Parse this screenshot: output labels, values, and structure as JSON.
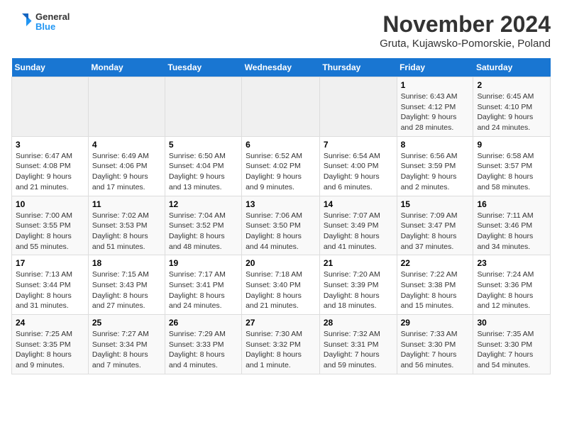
{
  "header": {
    "logo_line1": "General",
    "logo_line2": "Blue",
    "title": "November 2024",
    "subtitle": "Gruta, Kujawsko-Pomorskie, Poland"
  },
  "days_of_week": [
    "Sunday",
    "Monday",
    "Tuesday",
    "Wednesday",
    "Thursday",
    "Friday",
    "Saturday"
  ],
  "weeks": [
    [
      {
        "day": "",
        "info": ""
      },
      {
        "day": "",
        "info": ""
      },
      {
        "day": "",
        "info": ""
      },
      {
        "day": "",
        "info": ""
      },
      {
        "day": "",
        "info": ""
      },
      {
        "day": "1",
        "info": "Sunrise: 6:43 AM\nSunset: 4:12 PM\nDaylight: 9 hours and 28 minutes."
      },
      {
        "day": "2",
        "info": "Sunrise: 6:45 AM\nSunset: 4:10 PM\nDaylight: 9 hours and 24 minutes."
      }
    ],
    [
      {
        "day": "3",
        "info": "Sunrise: 6:47 AM\nSunset: 4:08 PM\nDaylight: 9 hours and 21 minutes."
      },
      {
        "day": "4",
        "info": "Sunrise: 6:49 AM\nSunset: 4:06 PM\nDaylight: 9 hours and 17 minutes."
      },
      {
        "day": "5",
        "info": "Sunrise: 6:50 AM\nSunset: 4:04 PM\nDaylight: 9 hours and 13 minutes."
      },
      {
        "day": "6",
        "info": "Sunrise: 6:52 AM\nSunset: 4:02 PM\nDaylight: 9 hours and 9 minutes."
      },
      {
        "day": "7",
        "info": "Sunrise: 6:54 AM\nSunset: 4:00 PM\nDaylight: 9 hours and 6 minutes."
      },
      {
        "day": "8",
        "info": "Sunrise: 6:56 AM\nSunset: 3:59 PM\nDaylight: 9 hours and 2 minutes."
      },
      {
        "day": "9",
        "info": "Sunrise: 6:58 AM\nSunset: 3:57 PM\nDaylight: 8 hours and 58 minutes."
      }
    ],
    [
      {
        "day": "10",
        "info": "Sunrise: 7:00 AM\nSunset: 3:55 PM\nDaylight: 8 hours and 55 minutes."
      },
      {
        "day": "11",
        "info": "Sunrise: 7:02 AM\nSunset: 3:53 PM\nDaylight: 8 hours and 51 minutes."
      },
      {
        "day": "12",
        "info": "Sunrise: 7:04 AM\nSunset: 3:52 PM\nDaylight: 8 hours and 48 minutes."
      },
      {
        "day": "13",
        "info": "Sunrise: 7:06 AM\nSunset: 3:50 PM\nDaylight: 8 hours and 44 minutes."
      },
      {
        "day": "14",
        "info": "Sunrise: 7:07 AM\nSunset: 3:49 PM\nDaylight: 8 hours and 41 minutes."
      },
      {
        "day": "15",
        "info": "Sunrise: 7:09 AM\nSunset: 3:47 PM\nDaylight: 8 hours and 37 minutes."
      },
      {
        "day": "16",
        "info": "Sunrise: 7:11 AM\nSunset: 3:46 PM\nDaylight: 8 hours and 34 minutes."
      }
    ],
    [
      {
        "day": "17",
        "info": "Sunrise: 7:13 AM\nSunset: 3:44 PM\nDaylight: 8 hours and 31 minutes."
      },
      {
        "day": "18",
        "info": "Sunrise: 7:15 AM\nSunset: 3:43 PM\nDaylight: 8 hours and 27 minutes."
      },
      {
        "day": "19",
        "info": "Sunrise: 7:17 AM\nSunset: 3:41 PM\nDaylight: 8 hours and 24 minutes."
      },
      {
        "day": "20",
        "info": "Sunrise: 7:18 AM\nSunset: 3:40 PM\nDaylight: 8 hours and 21 minutes."
      },
      {
        "day": "21",
        "info": "Sunrise: 7:20 AM\nSunset: 3:39 PM\nDaylight: 8 hours and 18 minutes."
      },
      {
        "day": "22",
        "info": "Sunrise: 7:22 AM\nSunset: 3:38 PM\nDaylight: 8 hours and 15 minutes."
      },
      {
        "day": "23",
        "info": "Sunrise: 7:24 AM\nSunset: 3:36 PM\nDaylight: 8 hours and 12 minutes."
      }
    ],
    [
      {
        "day": "24",
        "info": "Sunrise: 7:25 AM\nSunset: 3:35 PM\nDaylight: 8 hours and 9 minutes."
      },
      {
        "day": "25",
        "info": "Sunrise: 7:27 AM\nSunset: 3:34 PM\nDaylight: 8 hours and 7 minutes."
      },
      {
        "day": "26",
        "info": "Sunrise: 7:29 AM\nSunset: 3:33 PM\nDaylight: 8 hours and 4 minutes."
      },
      {
        "day": "27",
        "info": "Sunrise: 7:30 AM\nSunset: 3:32 PM\nDaylight: 8 hours and 1 minute."
      },
      {
        "day": "28",
        "info": "Sunrise: 7:32 AM\nSunset: 3:31 PM\nDaylight: 7 hours and 59 minutes."
      },
      {
        "day": "29",
        "info": "Sunrise: 7:33 AM\nSunset: 3:30 PM\nDaylight: 7 hours and 56 minutes."
      },
      {
        "day": "30",
        "info": "Sunrise: 7:35 AM\nSunset: 3:30 PM\nDaylight: 7 hours and 54 minutes."
      }
    ]
  ]
}
